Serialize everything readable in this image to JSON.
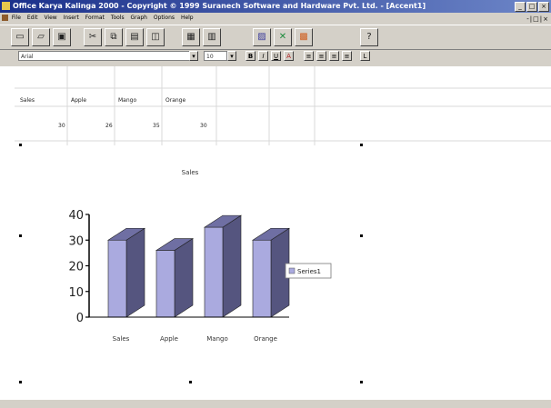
{
  "window": {
    "title": "Office Karya Kalinga 2000 - Copyright © 1999 Suranech Software and Hardware Pvt. Ltd. - [Accent1]",
    "controls": [
      "_",
      "□",
      "×"
    ],
    "mdi_controls": "-|□|×"
  },
  "menubar": {
    "items": [
      "File",
      "Edit",
      "View",
      "Insert",
      "Format",
      "Tools",
      "Graph",
      "Options",
      "Help"
    ]
  },
  "toolbar": {
    "buttons": [
      {
        "icon": "new-icon",
        "glyph": "▭"
      },
      {
        "icon": "open-icon",
        "glyph": "▱"
      },
      {
        "icon": "save-icon",
        "glyph": "▣"
      },
      {
        "icon": "cut-icon",
        "glyph": "✂"
      },
      {
        "icon": "copy-icon",
        "glyph": "⧉"
      },
      {
        "icon": "paste-icon",
        "glyph": "▤"
      },
      {
        "icon": "print-preview-icon",
        "glyph": "◫"
      },
      {
        "icon": "chart-wizard-icon",
        "glyph": "▦"
      },
      {
        "icon": "table-icon",
        "glyph": "▥"
      },
      {
        "icon": "insert-chart-icon",
        "glyph": "▨"
      },
      {
        "icon": "excel-icon",
        "glyph": "✕"
      },
      {
        "icon": "export-icon",
        "glyph": "▩"
      },
      {
        "icon": "help-icon",
        "glyph": "?"
      }
    ]
  },
  "formatbar": {
    "font_name": "Arial",
    "font_size": "10",
    "buttons": [
      "B",
      "I",
      "U",
      "A",
      "≡",
      "≡",
      "≡",
      "≡",
      "L"
    ]
  },
  "grid": {
    "header": [
      "Sales",
      "Apple",
      "Mango",
      "Orange"
    ],
    "values": [
      "30",
      "26",
      "35",
      "30"
    ]
  },
  "chart_data": {
    "type": "bar",
    "title": "Sales",
    "categories": [
      "Sales",
      "Apple",
      "Mango",
      "Orange"
    ],
    "series": [
      {
        "name": "Series1",
        "values": [
          30,
          26,
          35,
          30
        ],
        "color": "#aaaadf"
      }
    ],
    "ylim": [
      0,
      40
    ],
    "yticks": [
      0,
      10,
      20,
      30,
      40
    ],
    "legend": "right",
    "grid": false
  },
  "status": {
    "text": ""
  }
}
